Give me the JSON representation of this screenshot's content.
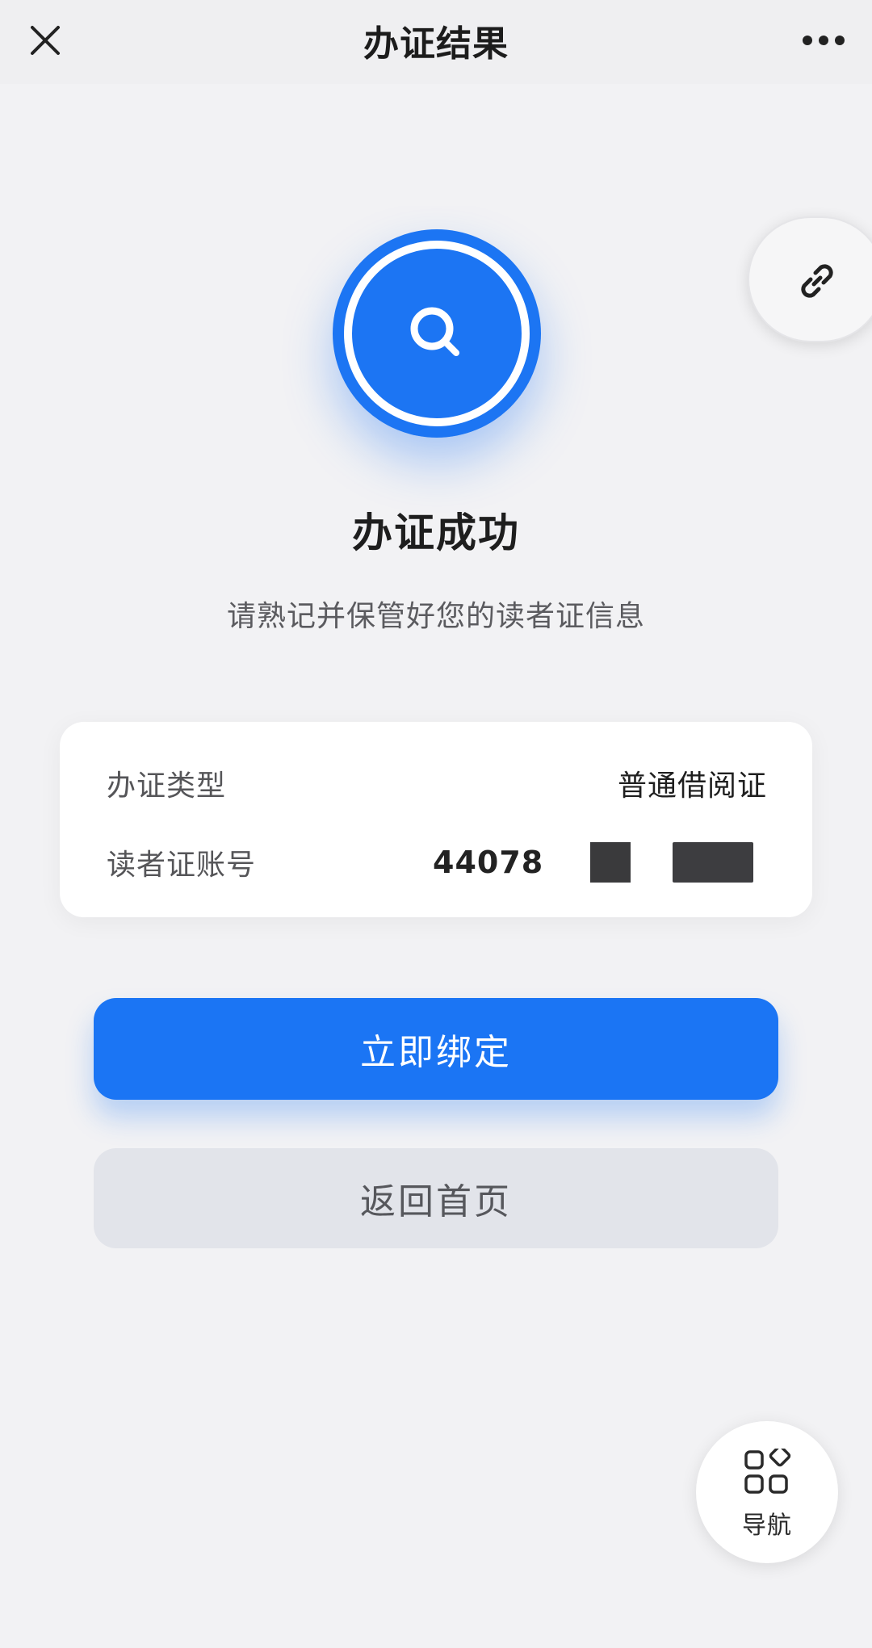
{
  "header": {
    "title": "办证结果",
    "close_icon": "close-icon",
    "more_icon": "more-horizontal-icon"
  },
  "floating_link": {
    "icon": "link-icon"
  },
  "status": {
    "icon": "search-icon",
    "title": "办证成功",
    "subtitle": "请熟记并保管好您的读者证信息"
  },
  "info_card": {
    "rows": [
      {
        "label": "办证类型",
        "value": "普通借阅证"
      },
      {
        "label": "读者证账号",
        "value": "44078"
      }
    ]
  },
  "actions": {
    "primary_label": "立即绑定",
    "secondary_label": "返回首页"
  },
  "floating_nav": {
    "icon": "grid-apps-icon",
    "label": "导航"
  },
  "colors": {
    "accent": "#1b75f4",
    "background": "#f2f2f4",
    "secondary_button": "#e2e4ea"
  }
}
